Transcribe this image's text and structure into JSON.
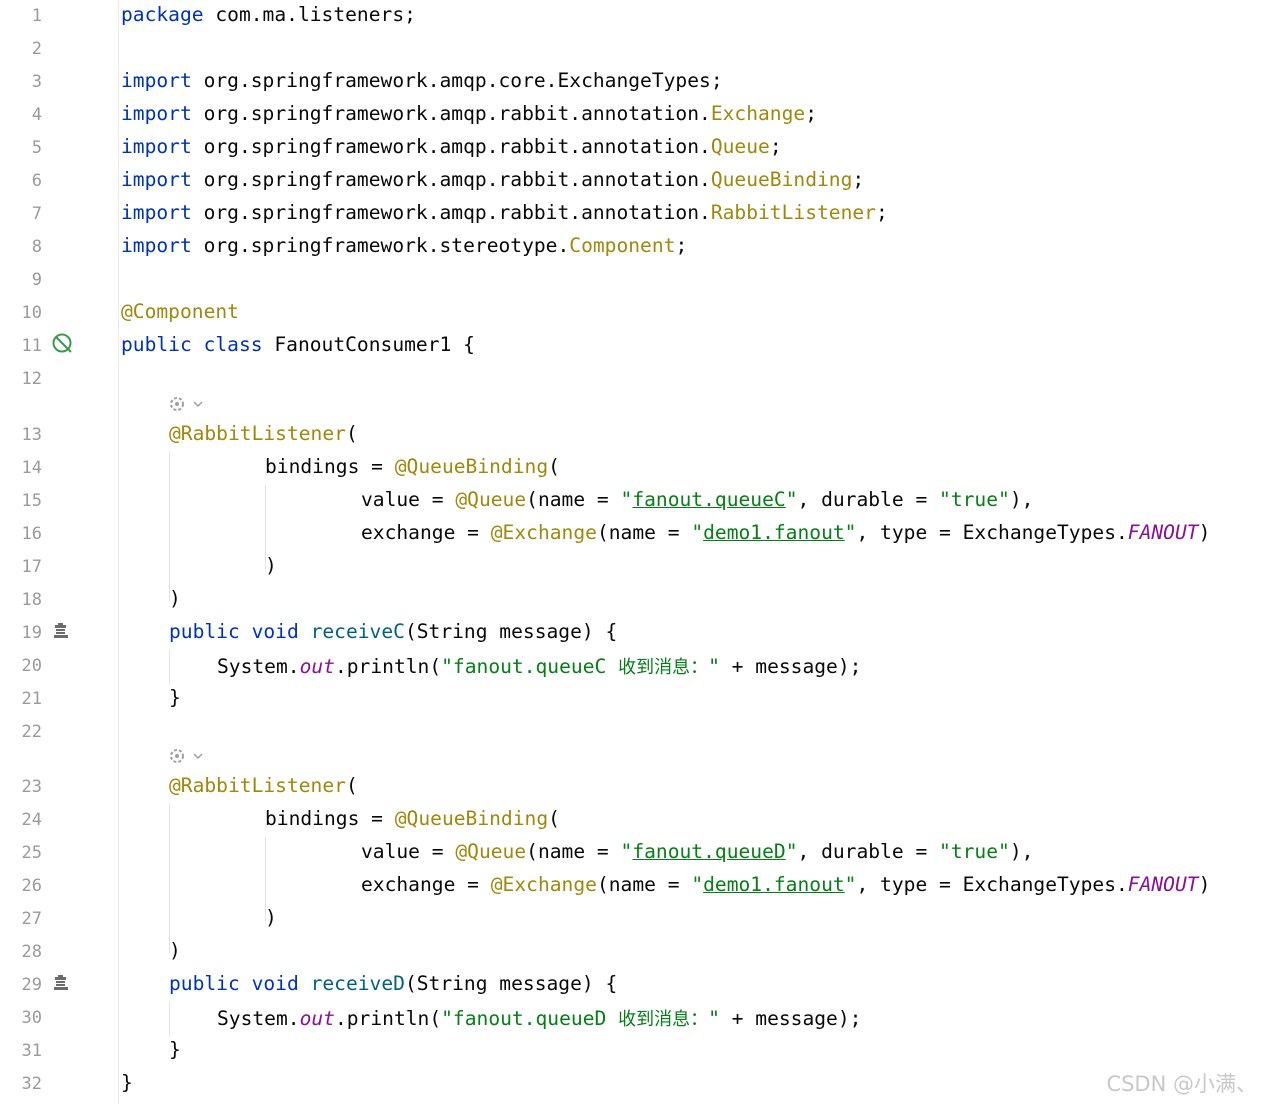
{
  "editor": {
    "lines": [
      {
        "n": "1"
      },
      {
        "n": "2"
      },
      {
        "n": "3"
      },
      {
        "n": "4"
      },
      {
        "n": "5"
      },
      {
        "n": "6"
      },
      {
        "n": "7"
      },
      {
        "n": "8"
      },
      {
        "n": "9"
      },
      {
        "n": "10"
      },
      {
        "n": "11"
      },
      {
        "n": "12"
      },
      {
        "n": "13"
      },
      {
        "n": "14"
      },
      {
        "n": "15"
      },
      {
        "n": "16"
      },
      {
        "n": "17"
      },
      {
        "n": "18"
      },
      {
        "n": "19"
      },
      {
        "n": "20"
      },
      {
        "n": "21"
      },
      {
        "n": "22"
      },
      {
        "n": "23"
      },
      {
        "n": "24"
      },
      {
        "n": "25"
      },
      {
        "n": "26"
      },
      {
        "n": "27"
      },
      {
        "n": "28"
      },
      {
        "n": "29"
      },
      {
        "n": "30"
      },
      {
        "n": "31"
      },
      {
        "n": "32"
      }
    ],
    "tokens": {
      "package_kw": "package",
      "package_name": " com.ma.listeners;",
      "import_kw": "import",
      "imp3": " org.springframework.amqp.core.ExchangeTypes;",
      "imp4_pkg": " org.springframework.amqp.rabbit.annotation.",
      "imp4_cls": "Exchange",
      "imp5_pkg": " org.springframework.amqp.rabbit.annotation.",
      "imp5_cls": "Queue",
      "imp6_pkg": " org.springframework.amqp.rabbit.annotation.",
      "imp6_cls": "QueueBinding",
      "imp7_pkg": " org.springframework.amqp.rabbit.annotation.",
      "imp7_cls": "RabbitListener",
      "imp8_pkg": " org.springframework.stereotype.",
      "imp8_cls": "Component",
      "semi": ";",
      "component_ann": "@Component",
      "public_kw": "public",
      "class_kw": "class",
      "class_decl": " FanoutConsumer1 {",
      "rabbit_ann": "@RabbitListener",
      "open_paren": "(",
      "close_paren": ")",
      "bindings_eq": "bindings = ",
      "qb_ann": "@QueueBinding",
      "value_eq": "value = ",
      "queue_ann": "@Queue",
      "name_eq": "(name = ",
      "quote": "\"",
      "queueC": "fanout.queueC",
      "queueD": "fanout.queueD",
      "durable_part": ", durable = ",
      "true_str": "\"true\"",
      "close_comma": "),",
      "exchange_eq": "exchange = ",
      "exchange_ann": "@Exchange",
      "exchange_name": "demo1.fanout",
      "type_part": ", type = ExchangeTypes.",
      "fanout_const": "FANOUT",
      "void_kw": "void",
      "receiveC": "receiveC",
      "receiveD": "receiveD",
      "method_params": "(String message) {",
      "sysout": "System.",
      "out": "out",
      "println": ".println(",
      "msgC_str": "\"fanout.queueC ",
      "msgD_str": "\"fanout.queueD ",
      "msg_cjk": "收到消息：",
      "msg_end": "\"",
      "plus_message": " + message);",
      "close_brace": "}"
    },
    "watermark": "CSDN @小满、"
  },
  "icons": {
    "line11": "spring-bean-icon",
    "line19": "method-run-icon",
    "line29": "method-run-icon",
    "hint1": "inlay-hint-icon",
    "hint2": "inlay-hint-icon"
  }
}
